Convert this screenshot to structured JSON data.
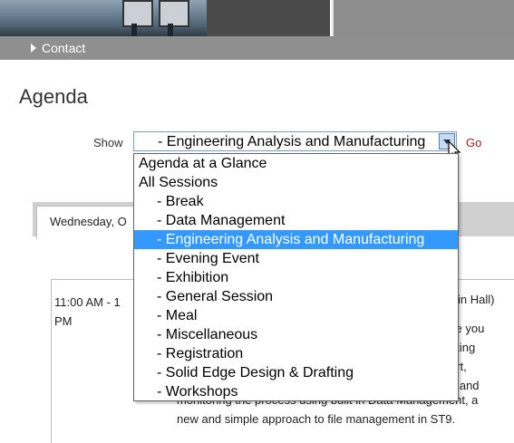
{
  "nav": {
    "contact_label": "Contact"
  },
  "page_title": "Agenda",
  "filter": {
    "show_label": "Show",
    "selected_value": "- Engineering Analysis and Manufacturing",
    "go_label": "Go",
    "options": [
      "Agenda at a Glance",
      "All Sessions",
      "- Break",
      "- Data Management",
      "- Engineering Analysis and Manufacturing",
      "- Evening Event",
      "- Exhibition",
      "- General Session",
      "- Meal",
      "- Miscellaneous",
      "- Registration",
      "- Solid Edge Design & Drafting",
      "- Workshops"
    ],
    "selected_index": 4
  },
  "tabs": {
    "active_label": "Wednesday, O"
  },
  "session": {
    "time": "11:00 AM  -  1",
    "time_suffix": "PM",
    "room_fragment": "ffin Hall)",
    "desc_fragments": [
      "ke you",
      "ating",
      "art,",
      "g and"
    ],
    "desc_line_partial": "monitoring the process using built in Data Management, a",
    "desc_line": "new and simple approach to file management in ST9."
  },
  "colors": {
    "highlight": "#3399ff",
    "go_link": "#9c1c1c",
    "navbar": "#8f8f8f"
  }
}
